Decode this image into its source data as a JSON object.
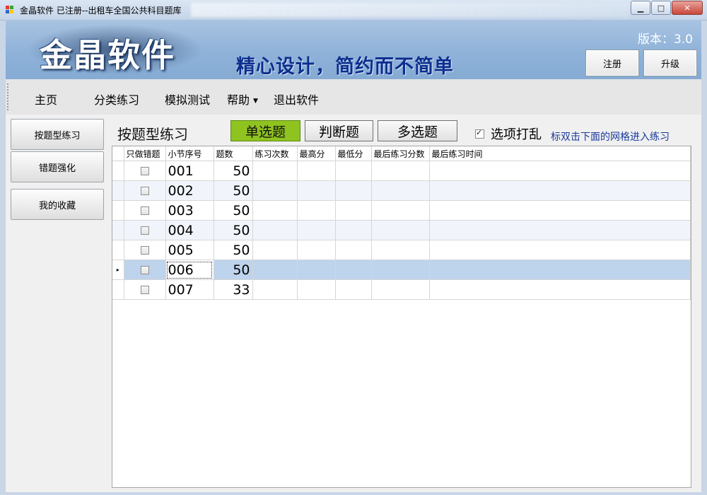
{
  "window": {
    "title": "金晶软件 已注册--出租车全国公共科目题库",
    "min_label": "▭",
    "max_label": "□",
    "close_label": "✕"
  },
  "banner": {
    "logo": "金晶软件",
    "slogan": "精心设计，简约而不简单",
    "version_label": "版本：3.0",
    "register_label": "注册",
    "upgrade_label": "升级"
  },
  "menu": {
    "home": "主页",
    "category": "分类练习",
    "mock": "模拟测试",
    "help": "帮助",
    "exit": "退出软件"
  },
  "sidebar": {
    "items": [
      {
        "label": "按题型练习"
      },
      {
        "label": "错题强化"
      },
      {
        "label": "我的收藏"
      }
    ]
  },
  "practice": {
    "title": "按题型练习",
    "single_choice": "单选题",
    "true_false": "判断题",
    "multiple_choice": "多选题",
    "shuffle_label": "选项打乱",
    "shuffle_checked": true,
    "hint": "标双击下面的网格进入练习"
  },
  "grid": {
    "columns": [
      "只做错题",
      "小节序号",
      "题数",
      "练习次数",
      "最高分",
      "最低分",
      "最后练习分数",
      "最后练习时间"
    ],
    "rows": [
      {
        "section": "001",
        "count": "50"
      },
      {
        "section": "002",
        "count": "50"
      },
      {
        "section": "003",
        "count": "50"
      },
      {
        "section": "004",
        "count": "50"
      },
      {
        "section": "005",
        "count": "50"
      },
      {
        "section": "006",
        "count": "50"
      },
      {
        "section": "007",
        "count": "33"
      }
    ],
    "current_row_marker": "▸"
  },
  "colors": {
    "banner": "#8db1d8",
    "active_tab": "#8fc31f",
    "selected_row": "#bed3ec",
    "hint_text": "#1a3a9c"
  }
}
